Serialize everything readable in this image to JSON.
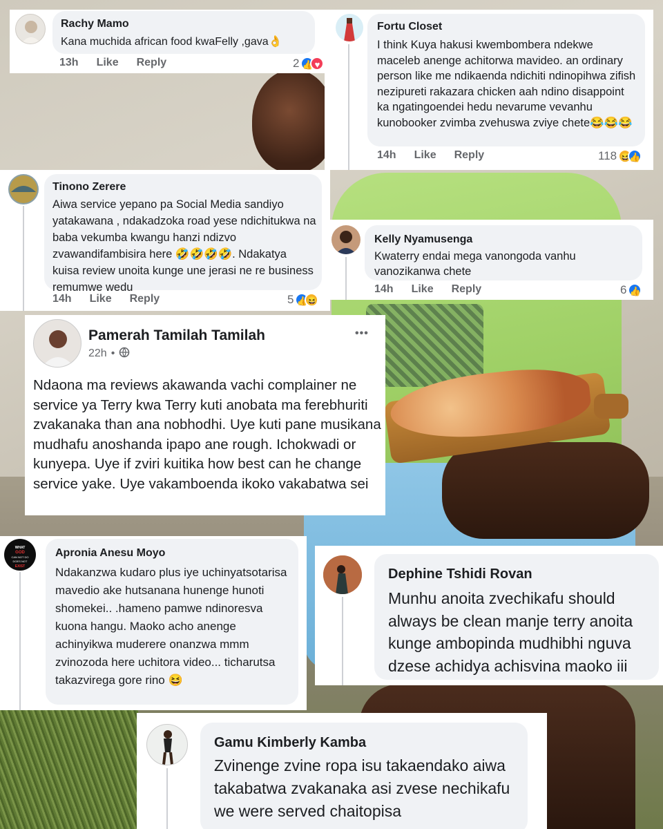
{
  "comments": {
    "rachy": {
      "name": "Rachy Mamo",
      "text": "Kana muchida african food kwaFelly ,gava👌",
      "time": "13h",
      "like": "Like",
      "reply": "Reply",
      "count": "2"
    },
    "fortu": {
      "name": "Fortu Closet",
      "text": "I think Kuya hakusi kwembombera ndekwe maceleb anenge achitorwa mavideo. an ordinary person like me ndikaenda ndichiti ndinopihwa zifish nezipureti rakazara chicken aah ndino disappoint ka ngatingoendei hedu nevarume vevanhu kunobooker zvimba zvehuswa zviye chete😂😂😂",
      "time": "14h",
      "like": "Like",
      "reply": "Reply",
      "count": "118"
    },
    "tinono": {
      "name": "Tinono Zerere",
      "text": "Aiwa service yepano pa Social Media sandiyo yatakawana , ndakadzoka road yese ndichitukwa na baba vekumba kwangu hanzi ndizvo zvawandifambisira here 🤣🤣🤣🤣. Ndakatya kuisa review unoita kunge une jerasi ne re business remumwe wedu",
      "time": "14h",
      "like": "Like",
      "reply": "Reply",
      "count": "5"
    },
    "kelly": {
      "name": "Kelly Nyamusenga",
      "text": "Kwaterry endai mega vanongoda vanhu vanozikanwa chete",
      "time": "14h",
      "like": "Like",
      "reply": "Reply",
      "count": "6"
    },
    "pamerah": {
      "name": "Pamerah Tamilah Tamilah",
      "time": "22h",
      "more": "•••",
      "text": "Ndaona ma reviews akawanda vachi complainer ne service  ya Terry  kwa Terry kuti anobata ma ferebhuriti zvakanaka  than ana nobhodhi. Uye kuti pane musikana mudhafu anoshanda ipapo ane rough. Ichokwadi or kunyepa. Uye if zviri kuitika how best can he change  service yake. Uye vakamboenda ikoko vakabatwa sei"
    },
    "apronia": {
      "name": "Apronia Anesu Moyo",
      "text": "Ndakanzwa kudaro plus iye uchinyatsotarisa mavedio ake hutsanana hunenge hunoti shomekei.. .hameno pamwe ndinoresva kuona hangu. Maoko acho anenge achinyikwa muderere onanzwa mmm zvinozoda here uchitora video... ticharutsa takazvirega gore rino 😆",
      "avatar_text": "WHAT GOD CAN NOT DO DOES NOT EXIST"
    },
    "dephine": {
      "name": "Dephine Tshidi Rovan",
      "text": "Munhu anoita zvechikafu should always be clean manje terry anoita kunge ambopinda mudhibhi nguva dzese achidya achisvina maoko iii"
    },
    "gamu": {
      "name": "Gamu Kimberly Kamba",
      "text": "Zvinenge zvine ropa isu takaendako aiwa takabatwa zvakanaka asi zvese nechikafu we were served chaitopisa"
    }
  },
  "icons": {
    "like": "like-reaction-icon",
    "heart": "love-reaction-icon",
    "haha": "haha-reaction-icon",
    "globe": "globe-icon",
    "more": "more-options-icon"
  },
  "colors": {
    "like_blue": "#1877f2",
    "bubble_gray": "#f0f2f5",
    "meta_gray": "#65676b",
    "text": "#1c1e21"
  }
}
